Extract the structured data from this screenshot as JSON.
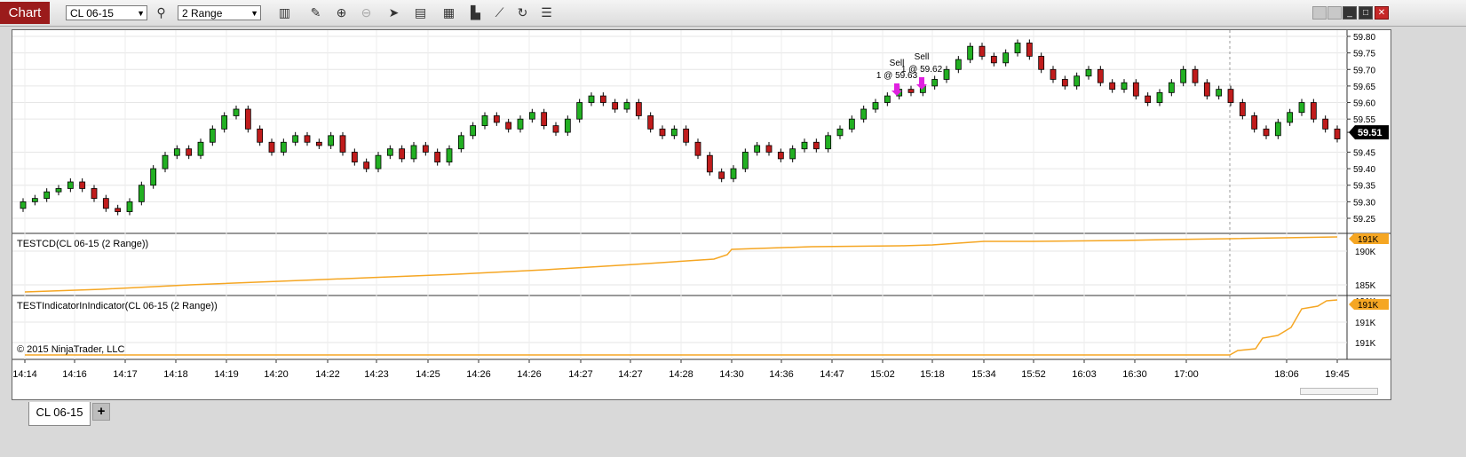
{
  "toolbar": {
    "chart_tab": "Chart",
    "instrument": "CL 06-15",
    "interval": "2 Range"
  },
  "panels": {
    "price": {
      "ticks": [
        "59.80",
        "59.75",
        "59.70",
        "59.65",
        "59.60",
        "59.55",
        "59.51",
        "59.45",
        "59.40",
        "59.35",
        "59.30",
        "59.25"
      ],
      "current": "59.51"
    },
    "ind1": {
      "label": "TESTCD(CL 06-15 (2 Range))",
      "ticks": [
        "191K",
        "190K",
        "185K"
      ]
    },
    "ind2": {
      "label": "TESTIndicatorInIndicator(CL 06-15 (2 Range))",
      "ticks": [
        "191K",
        "191K",
        "191K",
        "191K"
      ]
    }
  },
  "copyright": "© 2015 NinjaTrader, LLC",
  "time_axis": [
    "14:14",
    "14:16",
    "14:17",
    "14:18",
    "14:19",
    "14:20",
    "14:22",
    "14:23",
    "14:25",
    "14:26",
    "14:26",
    "14:27",
    "14:27",
    "14:28",
    "14:30",
    "14:36",
    "14:47",
    "15:02",
    "15:18",
    "15:34",
    "15:52",
    "16:03",
    "16:30",
    "17:00",
    "18:06",
    "19:45"
  ],
  "markers": [
    {
      "label": "Sell",
      "detail": "1 @ 59.63"
    },
    {
      "label": "Sell",
      "detail": "1 @ 59.62"
    }
  ],
  "chart_data": {
    "type": "candlestick",
    "series_name": "CL 06-15 (2 Range)",
    "close_path": [
      59.3,
      59.31,
      59.33,
      59.34,
      59.36,
      59.34,
      59.31,
      59.28,
      59.27,
      59.3,
      59.35,
      59.4,
      59.44,
      59.46,
      59.44,
      59.48,
      59.52,
      59.56,
      59.58,
      59.52,
      59.48,
      59.45,
      59.48,
      59.5,
      59.48,
      59.47,
      59.5,
      59.45,
      59.42,
      59.4,
      59.44,
      59.46,
      59.43,
      59.47,
      59.45,
      59.42,
      59.46,
      59.5,
      59.53,
      59.56,
      59.54,
      59.52,
      59.55,
      59.57,
      59.53,
      59.51,
      59.55,
      59.6,
      59.62,
      59.6,
      59.58,
      59.6,
      59.56,
      59.52,
      59.5,
      59.52,
      59.48,
      59.44,
      59.39,
      59.37,
      59.4,
      59.45,
      59.47,
      59.45,
      59.43,
      59.46,
      59.48,
      59.46,
      59.5,
      59.52,
      59.55,
      59.58,
      59.6,
      59.62,
      59.64,
      59.63,
      59.65,
      59.67,
      59.7,
      59.73,
      59.77,
      59.74,
      59.72,
      59.75,
      59.78,
      59.74,
      59.7,
      59.67,
      59.65,
      59.68,
      59.7,
      59.66,
      59.64,
      59.66,
      59.62,
      59.6,
      59.63,
      59.66,
      59.7,
      59.66,
      59.62,
      59.64,
      59.6,
      59.56,
      59.52,
      59.5,
      59.54,
      59.57,
      59.6,
      59.55,
      59.52,
      59.49
    ]
  },
  "bottom_tab": "CL 06-15",
  "add_tab": "+"
}
